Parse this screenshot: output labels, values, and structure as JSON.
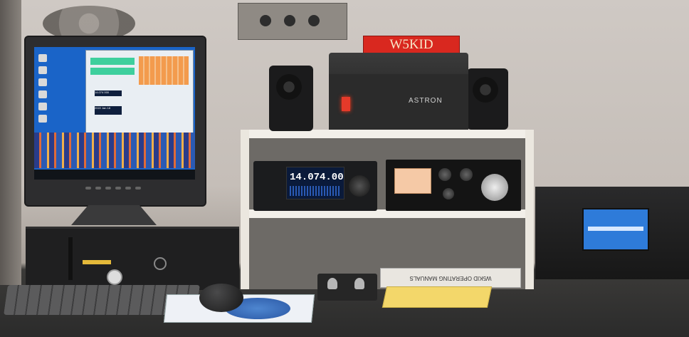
{
  "scene": {
    "sign_text": "W5KID",
    "power_supply_brand": "ASTRON",
    "radio_frequency": "14.074.00",
    "manuals_label": "W5KID OPERATING MANUALS",
    "software_freq_readout": "14.074 000",
    "software_date_readout": "2022 Jan 18"
  },
  "colors": {
    "wall": "#c5beb8",
    "shelf": "#f2efe9",
    "sign_red": "#d9281f",
    "screen_blue": "#1a64c8",
    "amp_lcd": "#2e7bd9",
    "notepad": "#f3d76a"
  }
}
